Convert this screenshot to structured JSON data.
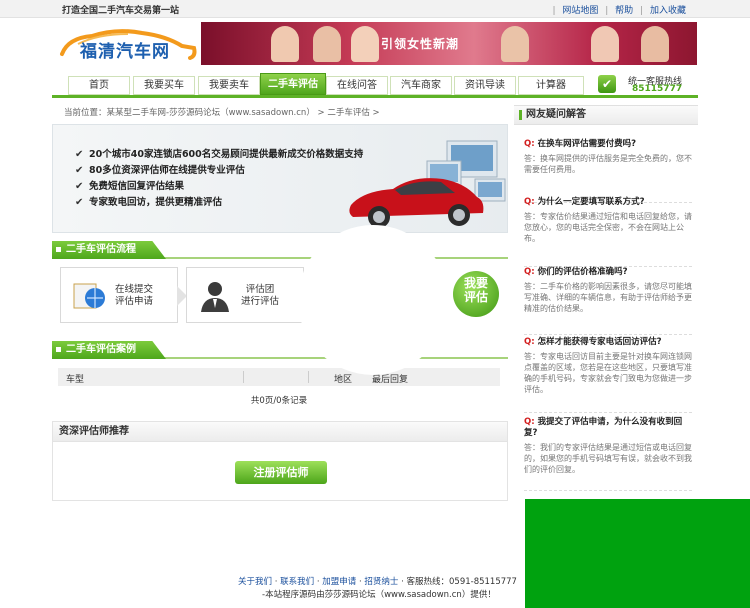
{
  "topbar": {
    "slogan": "打造全国二手汽车交易第一站",
    "links": [
      "网站地图",
      "帮助",
      "加入收藏"
    ],
    "sep": "|"
  },
  "logo": {
    "text": "福清汽车网"
  },
  "banner": {
    "text": "引领女性新潮"
  },
  "nav": {
    "items": [
      {
        "label": "首页"
      },
      {
        "label": "我要买车"
      },
      {
        "label": "我要卖车"
      },
      {
        "label": "二手车评估"
      },
      {
        "label": "在线问答"
      },
      {
        "label": "汽车商家"
      },
      {
        "label": "资讯导读"
      },
      {
        "label": "计算器"
      }
    ],
    "active_index": 3
  },
  "hotline": {
    "label": "统一客服热线",
    "number": "85115777"
  },
  "breadcrumb": "当前位置：某某型二手车网-莎莎源码论坛（www.sasadown.cn） > 二手车评估 >",
  "promo": {
    "items": [
      "20个城市40家连锁店600名交易顾问提供最新成交价格数据支持",
      "80多位资深评估师在线提供专业评估",
      "免费短信回复评估结果",
      "专家致电回访，提供更精准评估"
    ]
  },
  "flow": {
    "title": "二手车评估流程",
    "steps": [
      {
        "label1": "在线提交",
        "label2": "评估申请"
      },
      {
        "label1": "评估团",
        "label2": "进行评估"
      }
    ],
    "button_line1": "我要",
    "button_line2": "评估"
  },
  "cases": {
    "title": "二手车评估案例",
    "columns": [
      "车型",
      "地区",
      "最后回复"
    ],
    "pager": "共0页/0条记录"
  },
  "expert": {
    "title": "资深评估师推荐",
    "button": "注册评估师"
  },
  "sidebar": {
    "title": "网友疑问解答",
    "qa": [
      {
        "q_prefix": "Q:",
        "q": "在换车网评估需要付费吗?",
        "a_prefix": "答：",
        "a": "换车网提供的评估服务是完全免费的，您不需要任何费用。"
      },
      {
        "q_prefix": "Q:",
        "q": "为什么一定要填写联系方式?",
        "a_prefix": "答：",
        "a": "专家估价结果通过短信和电话回复给您，请您放心，您的电话完全保密，不会在网站上公布。"
      },
      {
        "q_prefix": "Q:",
        "q": "你们的评估价格准确吗?",
        "a_prefix": "答：",
        "a": "二手车价格的影响因素很多，请您尽可能填写准确、详细的车辆信息，有助于评估师给予更精准的估价结果。"
      },
      {
        "q_prefix": "Q:",
        "q": "怎样才能获得专家电话回访评估?",
        "a_prefix": "答：",
        "a": "专家电话回访目前主要是针对换车网连锁网点覆盖的区域，您若是在这些地区，只要填写准确的手机号码，专家就会专门致电为您做进一步评估。"
      },
      {
        "q_prefix": "Q:",
        "q": "我提交了评估申请，为什么没有收到回复?",
        "a_prefix": "答：",
        "a": "我们的专家评估结果是通过短信或电话回复的，如果您的手机号码填写有误，就会收不到我们的评价回复。"
      }
    ]
  },
  "footer": {
    "links": [
      "关于我们",
      "联系我们",
      "加盟申请",
      "招贤纳士"
    ],
    "sep": "·",
    "hotline_label": "客服热线：0591-85115777",
    "copyright": "-本站程序源码由莎莎源码论坛（www.sasadown.cn）提供！"
  },
  "colors": {
    "accent": "#5db226",
    "link": "#1a4f9c",
    "question_mark": "#d21f1f",
    "green_block": "#00a20f"
  }
}
